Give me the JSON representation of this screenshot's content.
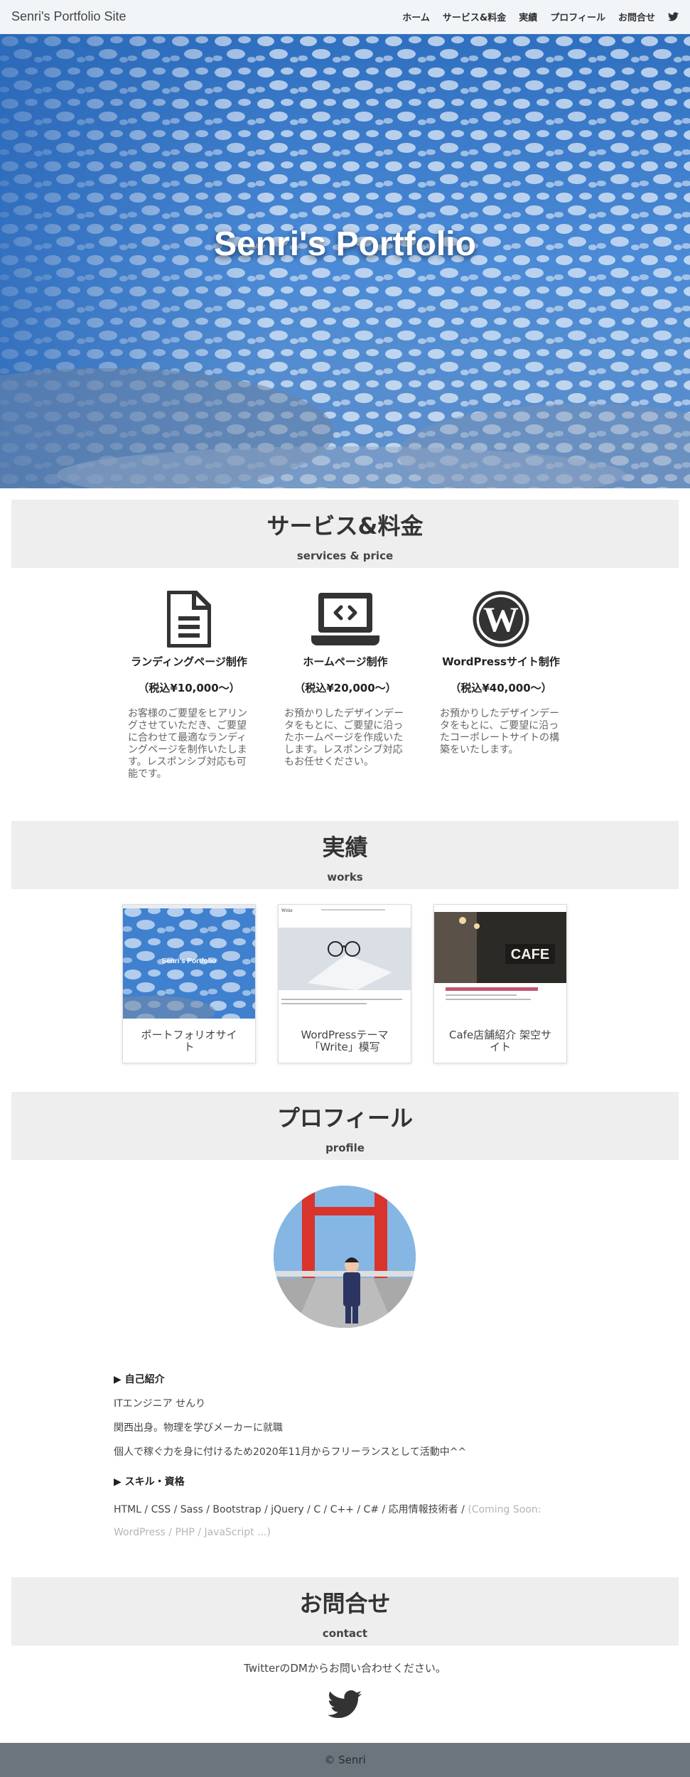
{
  "navbar": {
    "brand": "Senri's Portfolio Site",
    "links": [
      "ホーム",
      "サービス&料金",
      "実績",
      "プロフィール",
      "お問合せ"
    ],
    "twitter_icon": "twitter-icon"
  },
  "hero": {
    "title": "Senri's Portfolio"
  },
  "services": {
    "title": "サービス&料金",
    "subtitle": "services & price",
    "items": [
      {
        "icon": "document-icon",
        "name": "ランディングページ制作",
        "price": "（税込¥10,000〜）",
        "desc": "お客様のご要望をヒアリングさせていただき、ご要望に合わせて最適なランディングページを制作いたします。レスポンシブ対応も可能です。"
      },
      {
        "icon": "laptop-code-icon",
        "name": "ホームページ制作",
        "price": "（税込¥20,000〜）",
        "desc": "お預かりしたデザインデータをもとに、ご要望に沿ったホームページを作成いたします。レスポンシブ対応もお任せください。"
      },
      {
        "icon": "wordpress-icon",
        "name": "WordPressサイト制作",
        "price": "（税込¥40,000〜）",
        "desc": "お預かりしたデザインデータをもとに、ご要望に沿ったコーポレートサイトの構築をいたします。"
      }
    ]
  },
  "works": {
    "title": "実績",
    "subtitle": "works",
    "items": [
      {
        "caption": "ポートフォリオサイト",
        "thumb_text": "Senri's Portfolio"
      },
      {
        "caption": "WordPressテーマ「Write」模写",
        "thumb_text": "Write"
      },
      {
        "caption": "Cafe店舗紹介 架空サイト",
        "thumb_text": "CAFE"
      }
    ]
  },
  "profile": {
    "title": "プロフィール",
    "subtitle": "profile",
    "intro_heading": "▶ 自己紹介",
    "intro_lines": [
      "ITエンジニア せんり",
      "関西出身。物理を学びメーカーに就職",
      "個人で稼ぐ力を身に付けるため2020年11月からフリーランスとして活動中^^"
    ],
    "skills_heading": "▶ スキル・資格",
    "skills": "HTML / CSS / Sass / Bootstrap / jQuery / C / C++ / C# / 応用情報技術者 / ",
    "skills_soon": "(Coming Soon: WordPress / PHP / JavaScript ...)"
  },
  "contact": {
    "title": "お問合せ",
    "subtitle": "contact",
    "text": "TwitterのDMからお問い合わせください。",
    "icon": "twitter-icon"
  },
  "footer": {
    "text": "© Senri"
  },
  "colors": {
    "footer_bg": "#6c757d",
    "section_bg": "#eeeeee",
    "sky": "#3d7fd0"
  }
}
